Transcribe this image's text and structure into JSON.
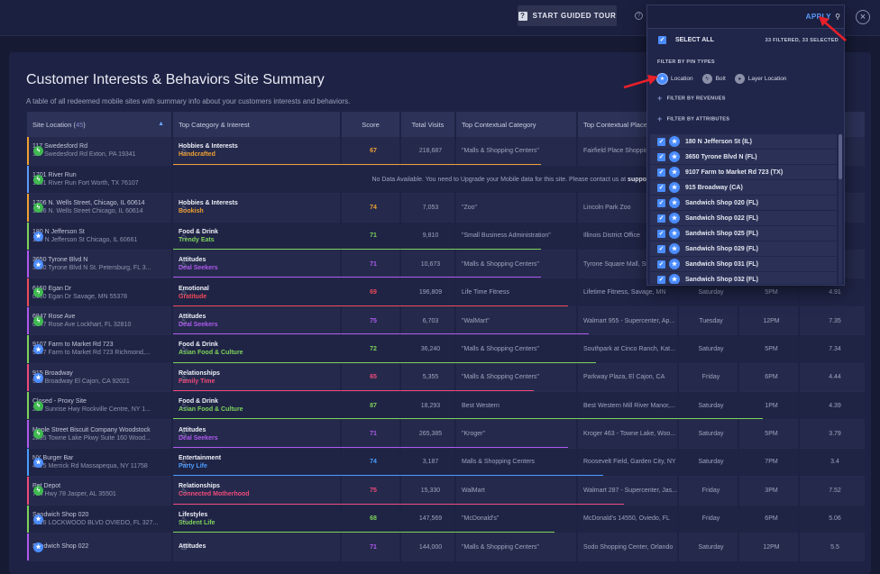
{
  "topbar": {
    "tour_label": "START GUIDED TOUR",
    "help_glyph": "?",
    "close_glyph": "×"
  },
  "page": {
    "title": "Customer Interests & Behaviors Site Summary",
    "subtitle": "A table of all redeemed mobile sites with summary info about your customers interests and behaviors."
  },
  "table": {
    "headers": {
      "site": "Site Location (",
      "site_count": "45",
      "site_close": ")",
      "category": "Top Category & Interest",
      "score": "Score",
      "visits": "Total Visits",
      "context": "Top Contextual Category",
      "place": "Top Contextual Place"
    },
    "rows": [
      {
        "type": "bolt",
        "name": "117 Swedesford Rd",
        "addr": "117 Swedesford Rd Exton, PA 19341",
        "cat": "Hobbies & Interests",
        "interest": "Handcrafted",
        "icolor": "#f0a030",
        "score": "67",
        "scolor": "#f0a030",
        "visits": "218,687",
        "context": "\"Malls & Shopping Centers\"",
        "place": "Fairfield Place Shopping",
        "day": "",
        "time": "",
        "avg": "",
        "bar": "#f0a030",
        "barw": 0.53
      },
      {
        "type": "bolt",
        "name": "1701 River Run",
        "addr": "1701 River Run Fort Worth, TX 76107",
        "nodata": true,
        "nodata_text": "No Data Available. You need to Upgrade your Mobile data for this site. Please contact us at ",
        "nodata_email": "support@sitez",
        "bar": "#5b9cff",
        "barw": 0
      },
      {
        "type": "bolt",
        "name": "1706 N. Wells Street, Chicago, IL 60614",
        "addr": "1706 N. Wells Street Chicago, IL 60614",
        "cat": "Hobbies & Interests",
        "interest": "Bookish",
        "icolor": "#f0a030",
        "score": "74",
        "scolor": "#f0a030",
        "visits": "7,053",
        "context": "\"Zoo\"",
        "place": "Lincoln Park Zoo",
        "day": "",
        "time": "",
        "avg": "",
        "bar": "#f0a030",
        "barw": 0
      },
      {
        "type": "star",
        "name": "180 N Jefferson St",
        "addr": "180 N Jefferson St Chicago, IL 60661",
        "cat": "Food & Drink",
        "interest": "Trendy Eats",
        "icolor": "#7dd35a",
        "score": "71",
        "scolor": "#7dd35a",
        "visits": "9,810",
        "context": "\"Small Business Administration\"",
        "place": "Illinois District Office",
        "day": "",
        "time": "",
        "avg": "",
        "bar": "#7dd35a",
        "barw": 0.53
      },
      {
        "type": "star",
        "name": "3650 Tyrone Blvd N",
        "addr": "3650 Tyrone Blvd N St. Petersburg, FL 3...",
        "cat": "Attitudes",
        "interest": "Deal Seekers",
        "icolor": "#b05af0",
        "score": "71",
        "scolor": "#b05af0",
        "visits": "10,673",
        "context": "\"Malls & Shopping Centers\"",
        "place": "Tyrone Square Mall, St.",
        "day": "",
        "time": "",
        "avg": "",
        "bar": "#b05af0",
        "barw": 0.53
      },
      {
        "type": "bolt",
        "name": "6150 Egan Dr",
        "addr": "6150 Egan Dr Savage, MN 55378",
        "cat": "Emotional",
        "interest": "Gratitude",
        "icolor": "#f04a5a",
        "score": "69",
        "scolor": "#f04a5a",
        "visits": "196,809",
        "context": "Life Time Fitness",
        "place": "Lifetime Fitness, Savage, MN",
        "day": "Saturday",
        "time": "5PM",
        "avg": "4.91",
        "bar": "#f04a5a",
        "barw": 0.57
      },
      {
        "type": "bolt",
        "name": "6847 Rose Ave",
        "addr": "6847 Rose Ave Lockhart, FL 32810",
        "cat": "Attitudes",
        "interest": "Deal Seekers",
        "icolor": "#b05af0",
        "score": "75",
        "scolor": "#b05af0",
        "visits": "6,703",
        "context": "\"WalMart\"",
        "place": "Walmart 955 - Supercenter, Ap...",
        "day": "Tuesday",
        "time": "12PM",
        "avg": "7.35",
        "bar": "#b05af0",
        "barw": 0.6
      },
      {
        "type": "star",
        "name": "9107 Farm to Market Rd 723",
        "addr": "9107 Farm to Market Rd 723 Richmond,...",
        "cat": "Food & Drink",
        "interest": "Asian Food & Culture",
        "icolor": "#7dd35a",
        "score": "72",
        "scolor": "#7dd35a",
        "visits": "36,240",
        "context": "\"Malls & Shopping Centers\"",
        "place": "Southpark at Cinco Ranch, Kat...",
        "day": "Saturday",
        "time": "5PM",
        "avg": "7.34",
        "bar": "#7dd35a",
        "barw": 0.61
      },
      {
        "type": "star",
        "name": "915 Broadway",
        "addr": "915 Broadway El Cajon, CA 92021",
        "cat": "Relationships",
        "interest": "Family Time",
        "icolor": "#f04a7a",
        "score": "65",
        "scolor": "#f04a7a",
        "visits": "5,355",
        "context": "\"Malls & Shopping Centers\"",
        "place": "Parkway Plaza, El Cajon, CA",
        "day": "Friday",
        "time": "6PM",
        "avg": "4.44",
        "bar": "#f04a7a",
        "barw": 0.52
      },
      {
        "type": "bolt",
        "name": "Closed - Proxy Site",
        "addr": "210 Sunrise Hwy Rockville Centre, NY 1...",
        "cat": "Food & Drink",
        "interest": "Asian Food & Culture",
        "icolor": "#7dd35a",
        "score": "87",
        "scolor": "#7dd35a",
        "visits": "18,293",
        "context": "Best Western",
        "place": "Best Western Mill River Manor,...",
        "day": "Saturday",
        "time": "1PM",
        "avg": "4.39",
        "bar": "#7dd35a",
        "barw": 0.85
      },
      {
        "type": "bolt",
        "name": "Maple Street Biscuit Company Woodstock",
        "addr": "2295 Towne Lake Pkwy Suite 160 Wood...",
        "cat": "Attitudes",
        "interest": "Deal Seekers",
        "icolor": "#b05af0",
        "score": "71",
        "scolor": "#b05af0",
        "visits": "265,385",
        "context": "\"Kroger\"",
        "place": "Kroger 463 - Towne Lake, Woo...",
        "day": "Saturday",
        "time": "5PM",
        "avg": "3.79",
        "bar": "#b05af0",
        "barw": 0.57
      },
      {
        "type": "star",
        "name": "NY Burger Bar",
        "addr": "4225 Merrick Rd Massapequa, NY 11758",
        "cat": "Entertainment",
        "interest": "Party Life",
        "icolor": "#4a9cff",
        "score": "74",
        "scolor": "#4a9cff",
        "visits": "3,187",
        "context": "Malls & Shopping Centers",
        "place": "Roosevelt Field, Garden City, NY",
        "day": "Saturday",
        "time": "7PM",
        "avg": "3.4",
        "bar": "#4a9cff",
        "barw": 0.62
      },
      {
        "type": "bolt",
        "name": "Pet Depot",
        "addr": "714 Hwy 78 Jasper, AL 35501",
        "cat": "Relationships",
        "interest": "Connected Motherhood",
        "icolor": "#f04a7a",
        "score": "75",
        "scolor": "#f04a7a",
        "visits": "15,330",
        "context": "WalMart",
        "place": "Walmart 287 - Supercenter, Jas...",
        "day": "Friday",
        "time": "3PM",
        "avg": "7.52",
        "bar": "#f04a7a",
        "barw": 0.65
      },
      {
        "type": "star",
        "name": "Sandwich Shop 020",
        "addr": "1016 LOCKWOOD BLVD OVIEDO, FL 327...",
        "cat": "Lifestyles",
        "interest": "Student Life",
        "icolor": "#7dd35a",
        "score": "68",
        "scolor": "#7dd35a",
        "visits": "147,569",
        "context": "\"McDonald's\"",
        "place": "McDonald's 14550, Oviedo, FL",
        "day": "Friday",
        "time": "6PM",
        "avg": "5.06",
        "bar": "#7dd35a",
        "barw": 0.55
      },
      {
        "type": "star",
        "name": "Sandwich Shop 022",
        "addr": "",
        "cat": "Attitudes",
        "interest": "",
        "icolor": "#b05af0",
        "score": "71",
        "scolor": "#b05af0",
        "visits": "144,000",
        "context": "\"Malls & Shopping Centers\"",
        "place": "Sodo Shopping Center, Orlando",
        "day": "Saturday",
        "time": "12PM",
        "avg": "5.5",
        "bar": "#b05af0",
        "barw": 0
      }
    ]
  },
  "dropdown": {
    "apply_label": "APPLY",
    "select_all_label": "SELECT ALL",
    "select_all_count": "33 FILTERED, 33 SELECTED",
    "pin_types_label": "FILTER BY PIN TYPES",
    "pin_location": "Location",
    "pin_bolt": "Bolt",
    "pin_layer": "Layer Location",
    "revenues_label": "FILTER BY REVENUES",
    "attributes_label": "FILTER BY ATTRIBUTES",
    "locations": [
      "180 N Jefferson St (IL)",
      "3650 Tyrone Blvd N (FL)",
      "9107 Farm to Market Rd 723 (TX)",
      "915 Broadway (CA)",
      "Sandwich Shop 020 (FL)",
      "Sandwich Shop 022 (FL)",
      "Sandwich Shop 025 (FL)",
      "Sandwich Shop 029 (FL)",
      "Sandwich Shop 031 (FL)",
      "Sandwich Shop 032 (FL)"
    ]
  },
  "colors": {
    "accent": "#4a8cff",
    "annotation_arrow": "#e8202a"
  },
  "icons": {
    "search": "search-icon",
    "star": "star-icon",
    "bolt": "bolt-icon",
    "flame": "flame-icon",
    "close": "close-icon",
    "help": "help-icon"
  }
}
